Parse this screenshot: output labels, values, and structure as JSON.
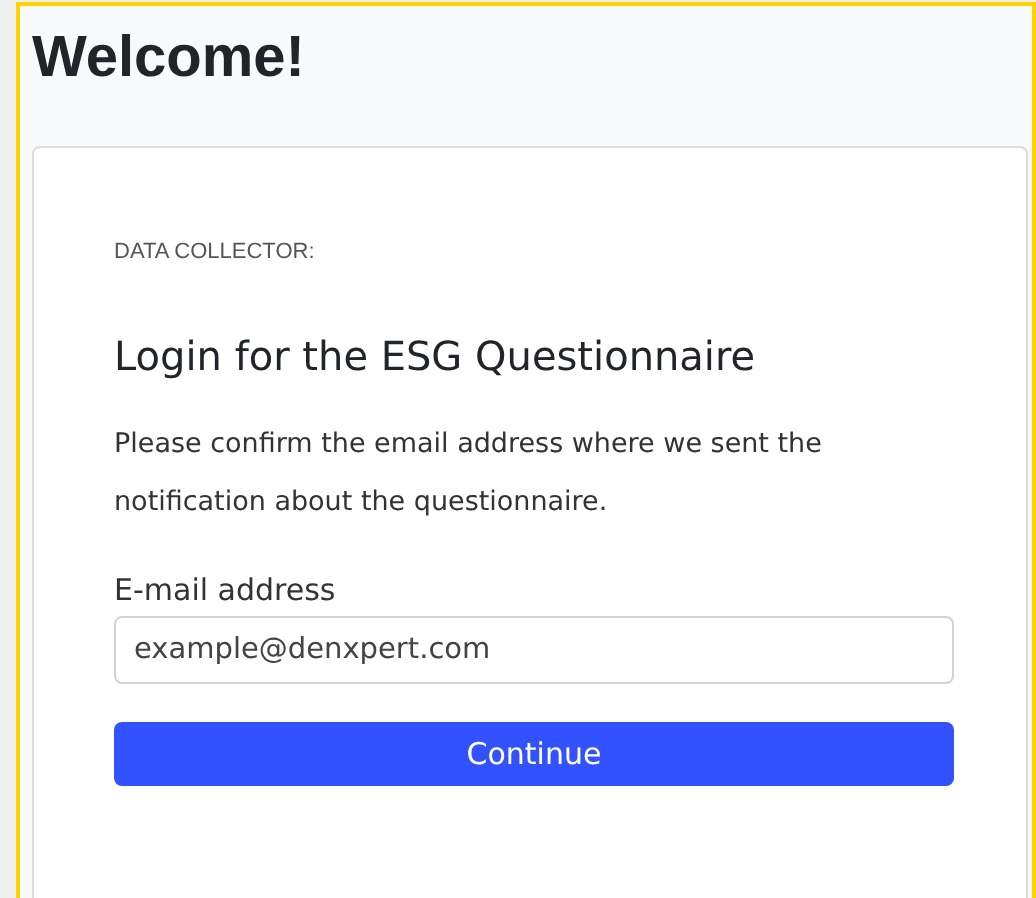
{
  "page_title": "Welcome!",
  "card": {
    "eyebrow": "DATA COLLECTOR:",
    "heading": "Login for the ESG Questionnaire",
    "description": "Please confirm the email address where we sent the notification about the questionnaire.",
    "email_field": {
      "label": "E-mail address",
      "value": "example@denxpert.com"
    },
    "button": "Continue"
  }
}
